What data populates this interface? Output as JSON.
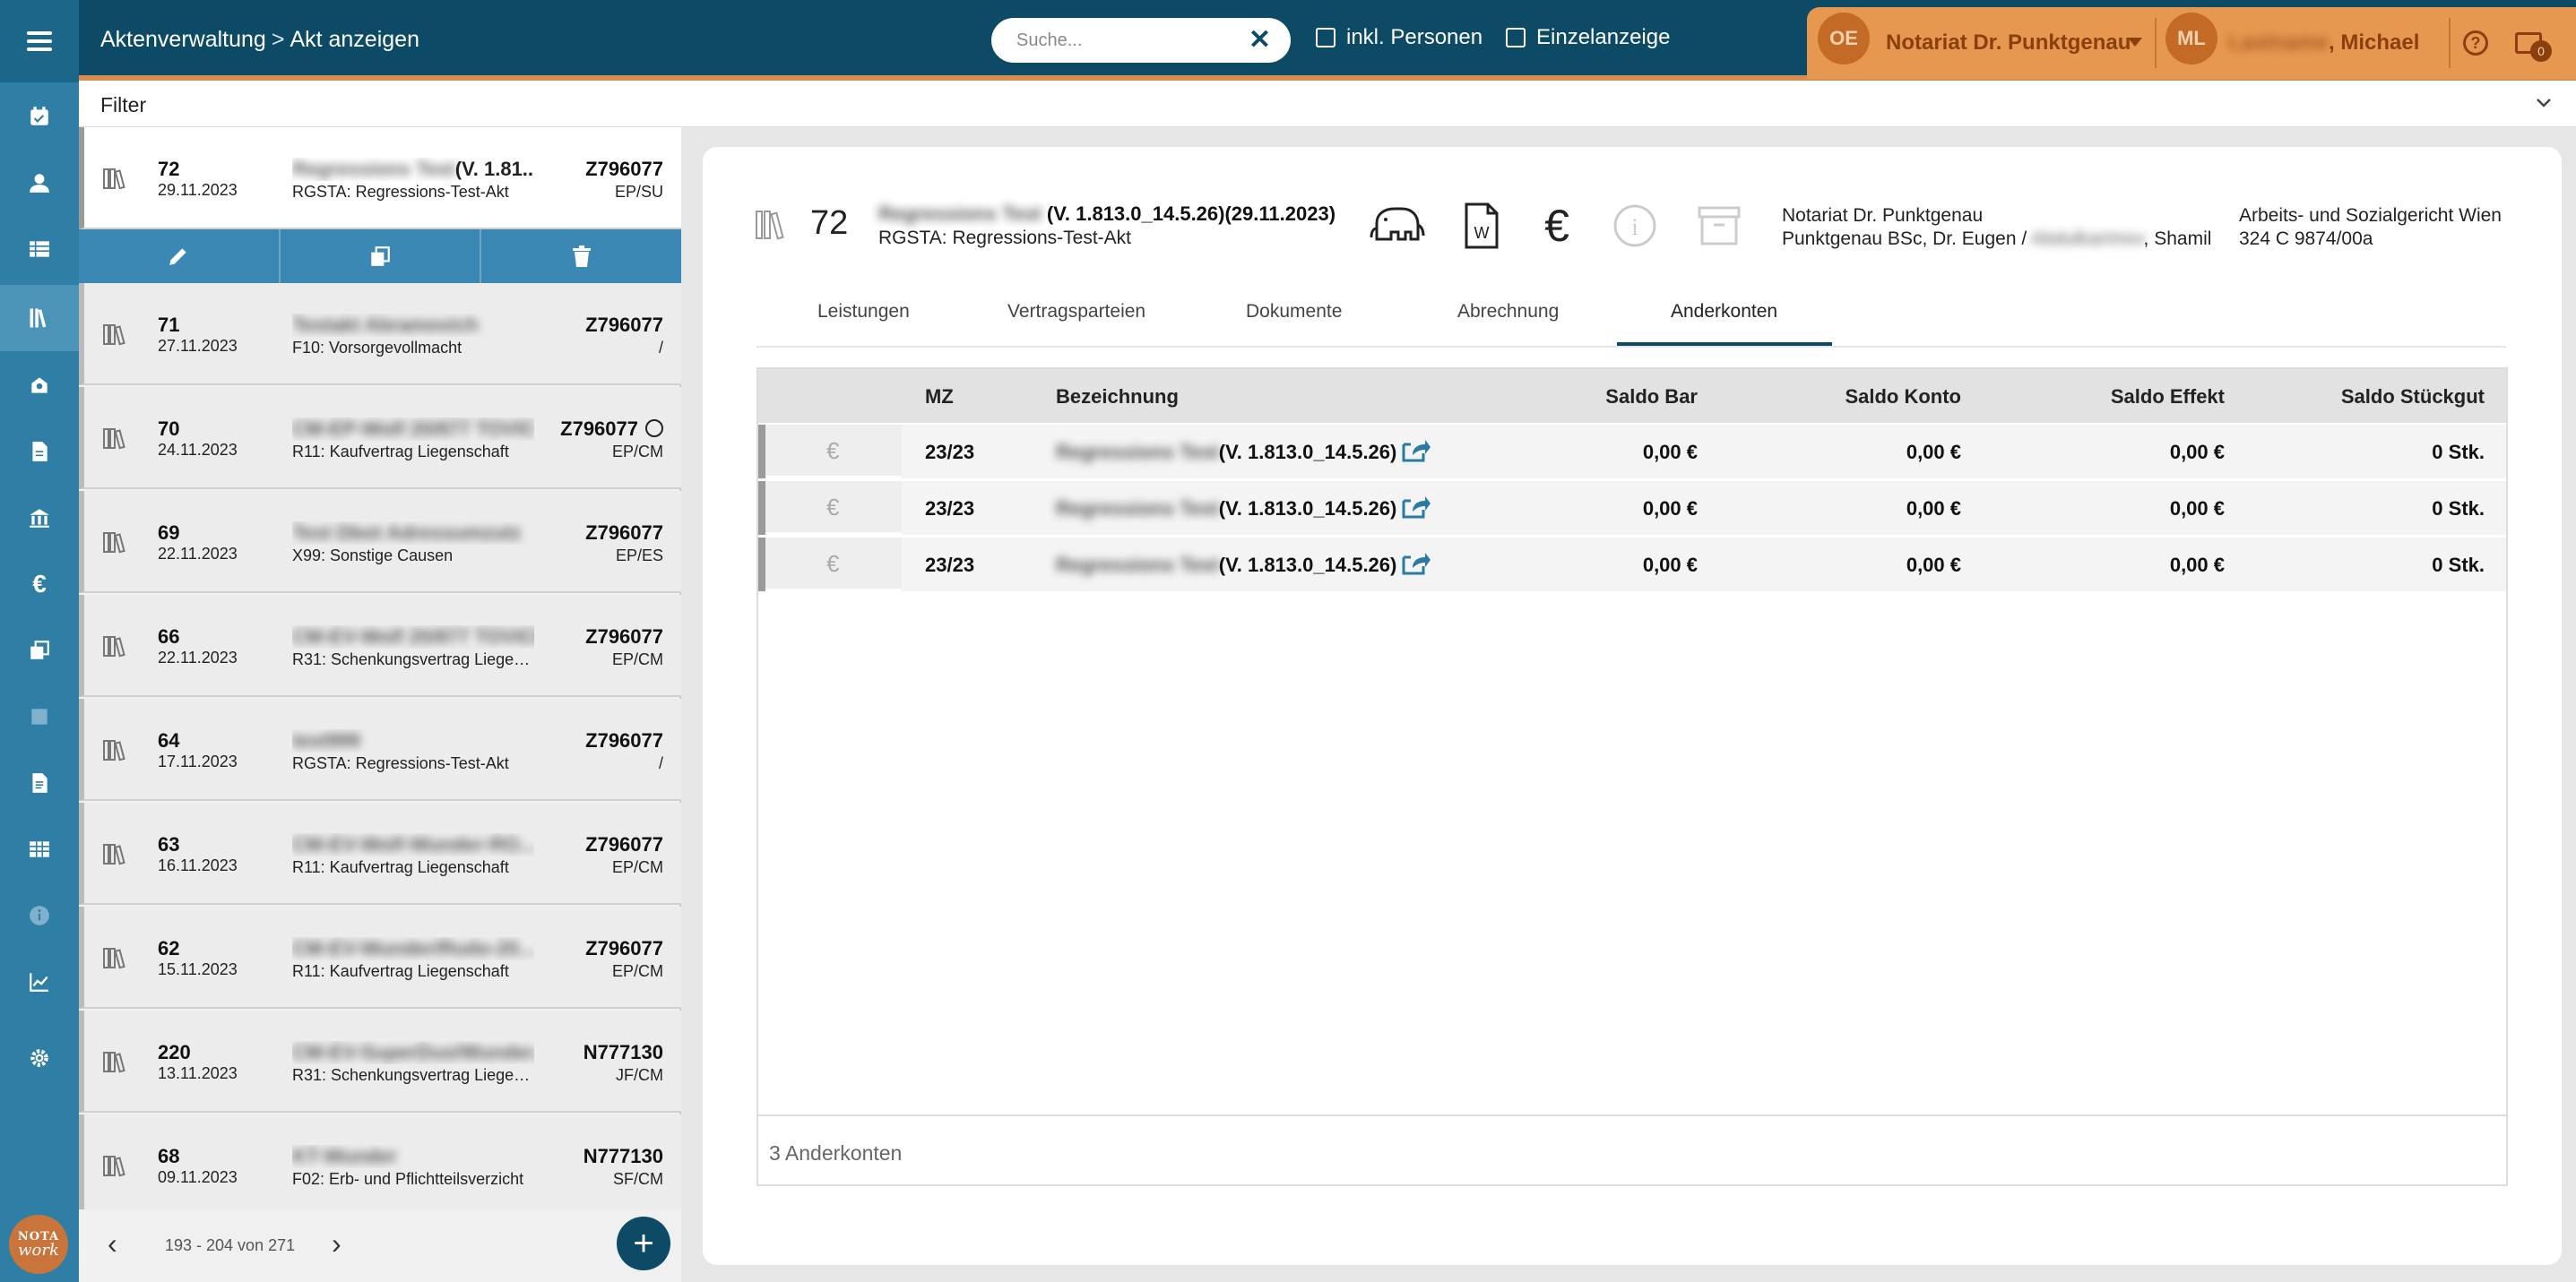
{
  "topbar": {
    "breadcrumb": [
      "Aktenverwaltung",
      "Akt anzeigen"
    ],
    "breadcrumb_sep": ">",
    "search_placeholder": "Suche...",
    "search_clear": "✕",
    "checkbox_personen": "inkl. Personen",
    "checkbox_einzelanzeige": "Einzelanzeige",
    "org_initials": "OE",
    "org_name": "Notariat Dr. Punktgenau",
    "user_initials": "ML",
    "user_name_redacted": "Lastname",
    "user_name_suffix": ", Michael",
    "help": "?",
    "mail_badge": "0"
  },
  "filter": {
    "label": "Filter",
    "chevron": "⌄"
  },
  "sidebar": {
    "icons": [
      "menu-icon",
      "calendar-check-icon",
      "person-icon",
      "table-icon",
      "books-icon",
      "bank-icon",
      "document-icon",
      "institution-icon",
      "euro-icon",
      "copy-icon",
      "square-icon",
      "file-icon",
      "grid-icon",
      "info-icon",
      "chart-icon",
      "gear-icon"
    ],
    "logo_line1": "NOTA",
    "logo_line2": "work"
  },
  "list": {
    "rows": [
      {
        "num": "72",
        "date": "29.11.2023",
        "name_blur": "Regressions Test",
        "name": "(V. 1.81...",
        "desc": "RGSTA: Regressions-Test-Akt",
        "z": "Z796077",
        "code": "EP/SU"
      },
      {
        "num": "71",
        "date": "27.11.2023",
        "name_blur": "Testakt Abramovich",
        "name": "",
        "desc": "F10: Vorsorgevollmacht",
        "z": "Z796077",
        "code": "/"
      },
      {
        "num": "70",
        "date": "24.11.2023",
        "name_blur": "CM-EP-Wolf 20/877 TOVIC",
        "name": "",
        "desc": "R11: Kaufvertrag Liegenschaft",
        "z": "Z796077",
        "code": "EP/CM",
        "clock": true
      },
      {
        "num": "69",
        "date": "22.11.2023",
        "name_blur": "Test Dbot Adressumzutz",
        "name": "",
        "desc": "X99: Sonstige Causen",
        "z": "Z796077",
        "code": "EP/ES"
      },
      {
        "num": "66",
        "date": "22.11.2023",
        "name_blur": "CM-EV-Wolf 20/877 TOVICH",
        "name": "",
        "desc": "R31: Schenkungsvertrag Liegen...",
        "z": "Z796077",
        "code": "EP/CM"
      },
      {
        "num": "64",
        "date": "17.11.2023",
        "name_blur": "test999",
        "name": "",
        "desc": "RGSTA: Regressions-Test-Akt",
        "z": "Z796077",
        "code": "/"
      },
      {
        "num": "63",
        "date": "16.11.2023",
        "name_blur": "CM-EV-Wolf-Wunder-RO...",
        "name": "",
        "desc": "R11: Kaufvertrag Liegenschaft",
        "z": "Z796077",
        "code": "EP/CM"
      },
      {
        "num": "62",
        "date": "15.11.2023",
        "name_blur": "CM-EV-Wunder/Rudo-20...",
        "name": "",
        "desc": "R11: Kaufvertrag Liegenschaft",
        "z": "Z796077",
        "code": "EP/CM"
      },
      {
        "num": "220",
        "date": "13.11.2023",
        "name_blur": "CM-EV-SuperDuo/Wunder...",
        "name": "",
        "desc": "R31: Schenkungsvertrag Liegen...",
        "z": "N777130",
        "code": "JF/CM"
      },
      {
        "num": "68",
        "date": "09.11.2023",
        "name_blur": "KT-Wunder",
        "name": "",
        "desc": "F02: Erb- und Pflichtteilsverzicht",
        "z": "N777130",
        "code": "SF/CM"
      }
    ],
    "actions": [
      "pencil-icon",
      "copy-icon",
      "trash-icon"
    ],
    "pager": "193 - 204 von 271",
    "prev": "‹",
    "next": "›",
    "fab": "+"
  },
  "detail": {
    "num": "72",
    "name_blur": "Regressions Test",
    "name": "(V. 1.813.0_14.5.26)(29.11.2023)",
    "desc": "RGSTA: Regressions-Test-Akt",
    "notar_line1": "Notariat Dr. Punktgenau",
    "notar_line2_a": "Punktgenau BSc, Dr. Eugen /",
    "notar_line2_blur": "Abdulkarimov",
    "notar_line2_b": ", Shamil",
    "court_line1": "Arbeits- und Sozialgericht Wien",
    "court_line2": "324 C 9874/00a",
    "euro": "€",
    "info": "i",
    "tabs": [
      "Leistungen",
      "Vertragsparteien",
      "Dokumente",
      "Abrechnung",
      "Anderkonten"
    ],
    "active_tab": "Anderkonten",
    "table": {
      "headers": [
        "MZ",
        "Bezeichnung",
        "Saldo Bar",
        "Saldo Konto",
        "Saldo Effekt",
        "Saldo Stückgut"
      ],
      "rows": [
        {
          "eur": "€",
          "mz": "23/23",
          "bez_blur": "Regressions Test",
          "bez": "(V. 1.813.0_14.5.26)",
          "bar": "0,00 €",
          "konto": "0,00 €",
          "effekt": "0,00 €",
          "stueck": "0 Stk."
        },
        {
          "eur": "€",
          "mz": "23/23",
          "bez_blur": "Regressions Test",
          "bez": "(V. 1.813.0_14.5.26)",
          "bar": "0,00 €",
          "konto": "0,00 €",
          "effekt": "0,00 €",
          "stueck": "0 Stk."
        },
        {
          "eur": "€",
          "mz": "23/23",
          "bez_blur": "Regressions Test",
          "bez": "(V. 1.813.0_14.5.26)",
          "bar": "0,00 €",
          "konto": "0,00 €",
          "effekt": "0,00 €",
          "stueck": "0 Stk."
        }
      ],
      "footer": "3 Anderkonten"
    }
  },
  "colors": {
    "topbar": "#0c4a66",
    "sidebar": "#2e7ea5",
    "accent": "#e79850",
    "action_bar": "#3a88b3"
  }
}
